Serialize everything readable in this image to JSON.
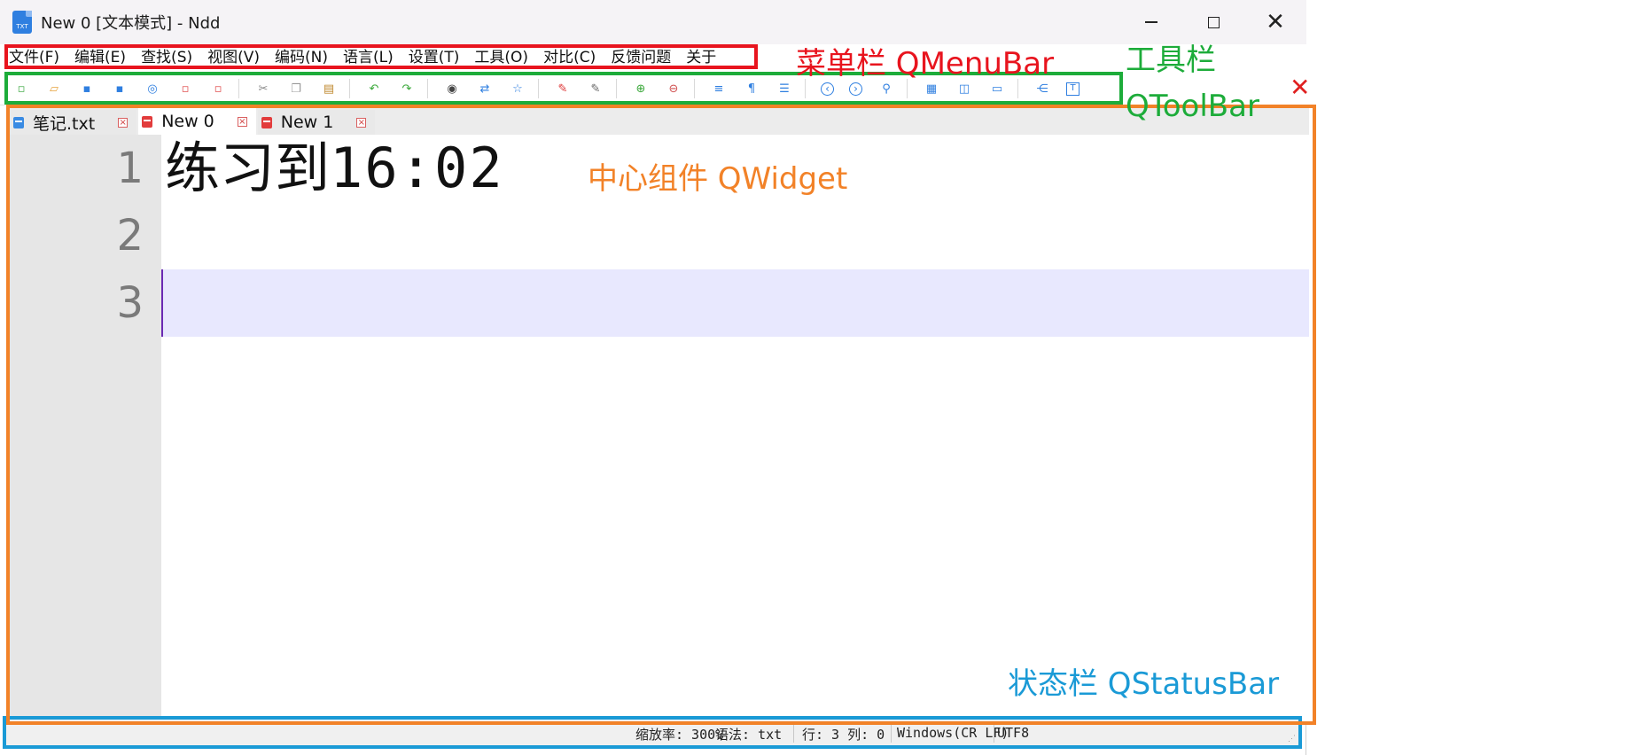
{
  "window": {
    "title": "New 0 [文本模式] - Ndd",
    "icon": "txt-file-icon",
    "icon_label": "TXT"
  },
  "menubar": {
    "items": [
      "文件(F)",
      "编辑(E)",
      "查找(S)",
      "视图(V)",
      "编码(N)",
      "语言(L)",
      "设置(T)",
      "工具(O)",
      "对比(C)",
      "反馈问题",
      "关于"
    ]
  },
  "toolbar": {
    "groups": [
      [
        "new-file-icon",
        "open-file-icon",
        "save-icon",
        "save-all-icon",
        "reload-icon",
        "close-file-icon",
        "close-all-icon"
      ],
      [
        "cut-icon",
        "copy-icon",
        "paste-icon"
      ],
      [
        "undo-icon",
        "redo-icon"
      ],
      [
        "find-icon",
        "replace-icon",
        "bookmark-icon"
      ],
      [
        "mark-icon",
        "clear-mark-icon"
      ],
      [
        "zoom-in-icon",
        "zoom-out-icon"
      ],
      [
        "word-wrap-icon",
        "show-symbols-icon",
        "indent-guide-icon"
      ],
      [
        "prev-icon",
        "next-icon",
        "goto-icon"
      ],
      [
        "column-select-icon",
        "split-view-icon",
        "monitor-icon"
      ],
      [
        "file-tree-icon",
        "text-mode-icon"
      ]
    ],
    "close_glyph": "✕"
  },
  "tabs": [
    {
      "label": "笔记.txt",
      "icon": "saved-file-icon",
      "color": "#3a8be3",
      "active": false
    },
    {
      "label": "New 0",
      "icon": "unsaved-file-icon",
      "color": "#e23c3c",
      "active": true
    },
    {
      "label": "New 1",
      "icon": "unsaved-file-icon",
      "color": "#e23c3c",
      "active": false
    }
  ],
  "editor": {
    "line_numbers": [
      "1",
      "2",
      "3"
    ],
    "lines": [
      {
        "cjk": "练习到",
        "mono": "16:02"
      },
      {
        "cjk": "",
        "mono": ""
      },
      {
        "cjk": "",
        "mono": ""
      }
    ],
    "current_line": 3
  },
  "annotations": {
    "menubar": "菜单栏 QMenuBar",
    "toolbar_line1": "工具栏",
    "toolbar_line2": "QToolBar",
    "central": "中心组件 QWidget",
    "statusbar": "状态栏 QStatusBar"
  },
  "statusbar": {
    "zoom": "缩放率: 300%",
    "syntax": "语法: txt",
    "position": "行: 3  列: 0",
    "line_ending": "Windows(CR LF)",
    "encoding": "UTF8"
  },
  "colors": {
    "menubar_box": "#e8141e",
    "toolbar_box": "#1dac3a",
    "central_box": "#f28228",
    "statusbar_box": "#1a9ad6",
    "current_line_bg": "#e8e8fe"
  }
}
